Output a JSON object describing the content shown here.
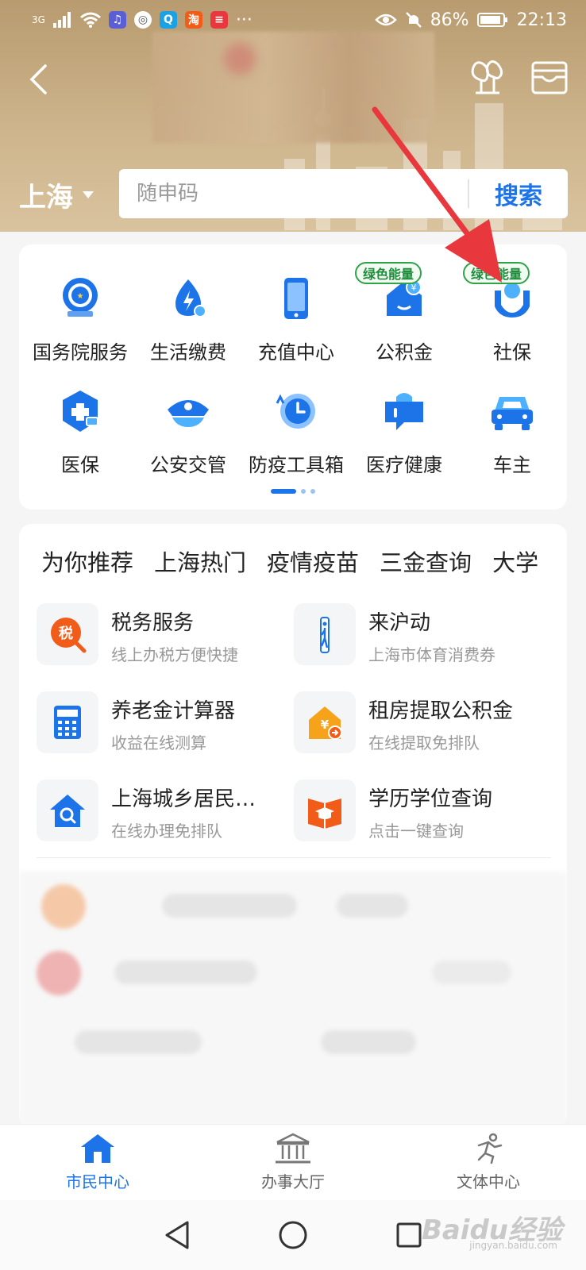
{
  "status_bar": {
    "signal": "3G",
    "apps": [
      "music-app",
      "browser-app",
      "search-app",
      "淘",
      "news-app"
    ],
    "more": "···",
    "battery": "86%",
    "time": "22:13"
  },
  "header": {
    "city": "上海",
    "search_placeholder": "随申码",
    "search_button": "搜索"
  },
  "services": [
    {
      "label": "国务院服务",
      "icon": "state-council-icon"
    },
    {
      "label": "生活缴费",
      "icon": "utility-payment-icon"
    },
    {
      "label": "充值中心",
      "icon": "phone-recharge-icon"
    },
    {
      "label": "公积金",
      "icon": "housing-fund-icon",
      "badge": "绿色能量"
    },
    {
      "label": "社保",
      "icon": "social-security-icon",
      "badge": "绿色能量"
    },
    {
      "label": "医保",
      "icon": "medical-insurance-icon"
    },
    {
      "label": "公安交管",
      "icon": "police-cap-icon"
    },
    {
      "label": "防疫工具箱",
      "icon": "epidemic-clock-icon"
    },
    {
      "label": "医疗健康",
      "icon": "health-chat-icon"
    },
    {
      "label": "车主",
      "icon": "car-icon"
    }
  ],
  "rec_tabs": [
    "为你推荐",
    "上海热门",
    "疫情疫苗",
    "三金查询",
    "大学"
  ],
  "recommendations": [
    {
      "title": "税务服务",
      "subtitle": "线上办税方便快捷",
      "icon": "tax-icon"
    },
    {
      "title": "来沪动",
      "subtitle": "上海市体育消费券",
      "icon": "sport-icon"
    },
    {
      "title": "养老金计算器",
      "subtitle": "收益在线测算",
      "icon": "calculator-icon"
    },
    {
      "title": "租房提取公积金",
      "subtitle": "在线提取免排队",
      "icon": "rent-house-icon"
    },
    {
      "title": "上海城乡居民…",
      "subtitle": "在线办理免排队",
      "icon": "house-search-icon"
    },
    {
      "title": "学历学位查询",
      "subtitle": "点击一键查询",
      "icon": "graduation-icon"
    }
  ],
  "bottom_nav": [
    {
      "label": "市民中心",
      "icon": "home-icon",
      "active": true
    },
    {
      "label": "办事大厅",
      "icon": "government-hall-icon",
      "active": false
    },
    {
      "label": "文体中心",
      "icon": "running-person-icon",
      "active": false
    }
  ],
  "watermark": {
    "text": "Baidu经验",
    "sub": "jingyan.baidu.com"
  },
  "colors": {
    "accent": "#1d74e8",
    "header_gold": "#cdb48c",
    "badge_green": "#2fa24a",
    "annotation_red": "#e8383d"
  }
}
